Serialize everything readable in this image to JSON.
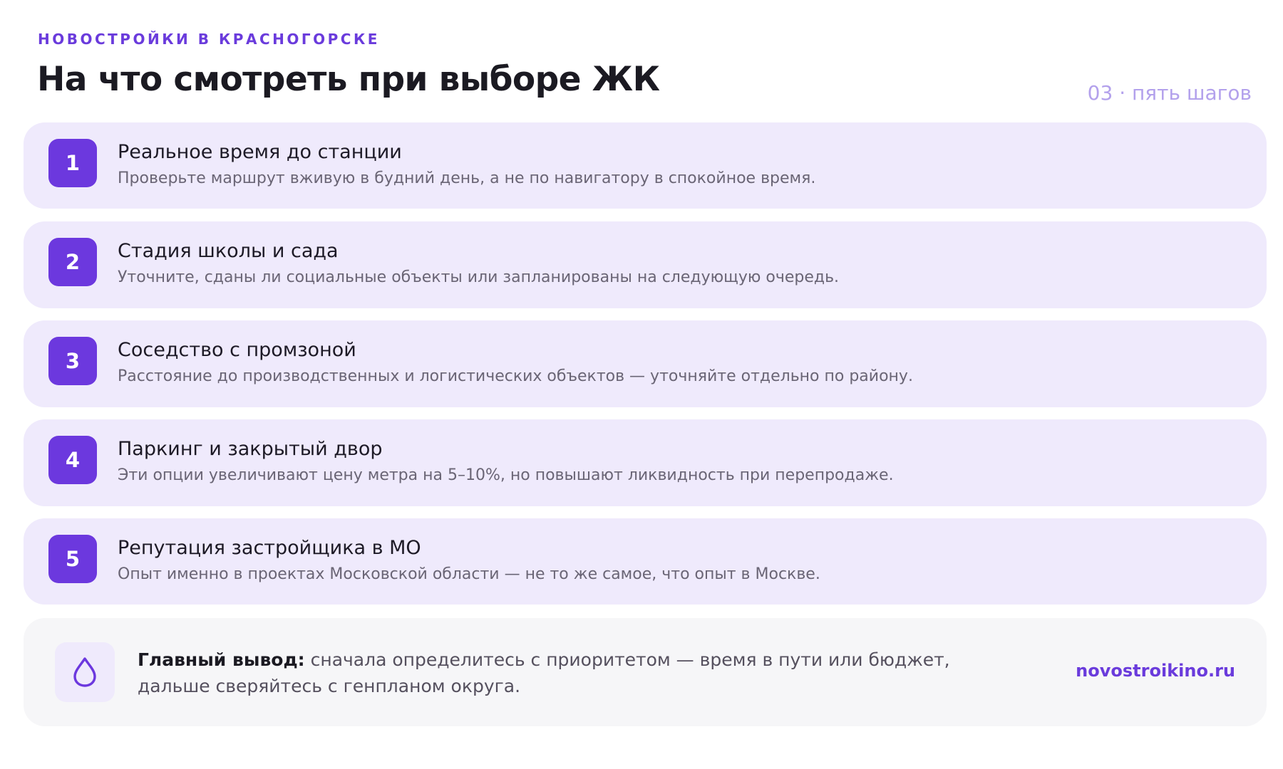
{
  "header": {
    "eyebrow": "НОВОСТРОЙКИ В КРАСНОГОРСКЕ",
    "title": "На что смотреть при выборе ЖК",
    "meta": "03 · пять шагов"
  },
  "steps": [
    {
      "num": "1",
      "title": "Реальное время до станции",
      "desc": "Проверьте маршрут вживую в будний день, а не по навигатору в спокойное время."
    },
    {
      "num": "2",
      "title": "Стадия школы и сада",
      "desc": "Уточните, сданы ли социальные объекты или запланированы на следующую очередь."
    },
    {
      "num": "3",
      "title": "Соседство с промзоной",
      "desc": "Расстояние до производственных и логистических объектов — уточняйте отдельно по району."
    },
    {
      "num": "4",
      "title": "Паркинг и закрытый двор",
      "desc": "Эти опции увеличивают цену метра на 5–10%, но повышают ликвидность при перепродаже."
    },
    {
      "num": "5",
      "title": "Репутация застройщика в МО",
      "desc": "Опыт именно в проектах Московской области — не то же самое, что опыт в Москве."
    }
  ],
  "conclusion": {
    "icon": "drop-icon",
    "label": "Главный вывод:",
    "text": " сначала определитесь с приоритетом — время в пути или бюджет, дальше сверяйтесь с генпланом округа.",
    "site": "novostroikino.ru"
  },
  "colors": {
    "accent": "#6c38de",
    "card_bg": "#efeafc",
    "muted": "#b3a1ec",
    "conclusion_bg": "#f6f6f8"
  }
}
